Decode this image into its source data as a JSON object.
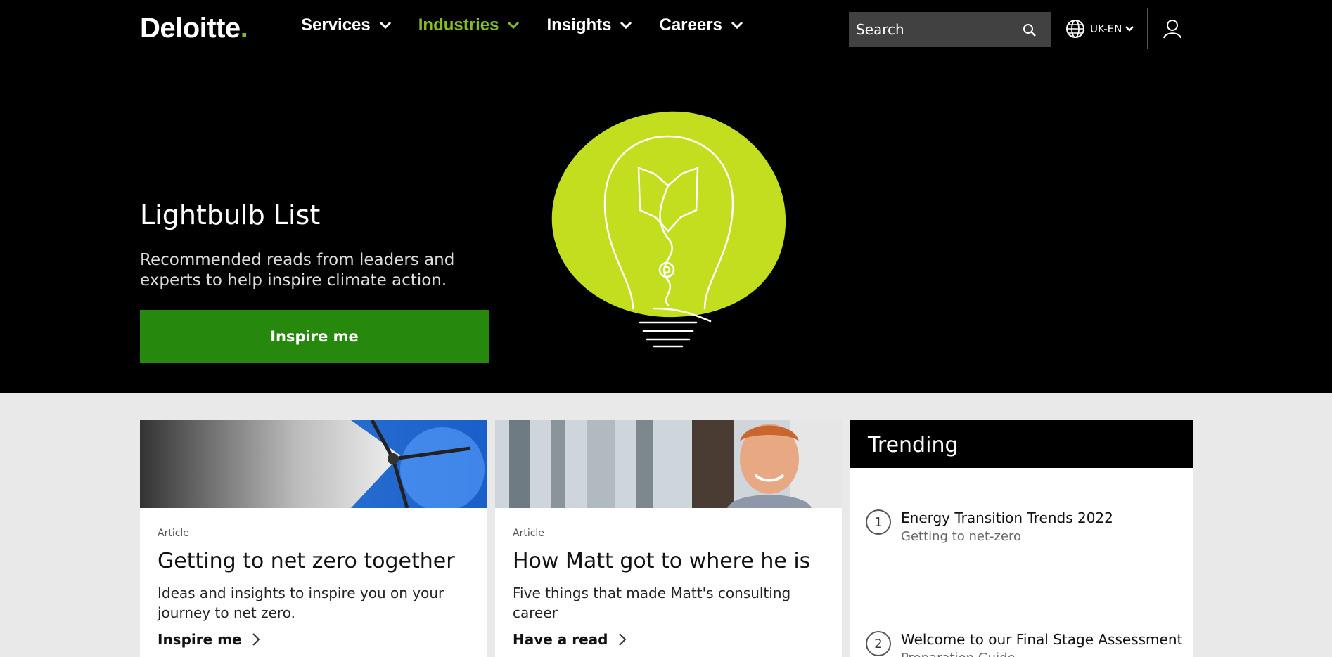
{
  "header": {
    "logo_text": "Deloitte",
    "logo_dot": ".",
    "nav": [
      {
        "label": "Services"
      },
      {
        "label": "Industries"
      },
      {
        "label": "Insights"
      },
      {
        "label": "Careers"
      }
    ],
    "search_placeholder": "Search",
    "language": "UK-EN",
    "colors": {
      "brand_green": "#86bc25",
      "button_green": "#26890d"
    }
  },
  "hero": {
    "title": "Lightbulb List",
    "subtitle": "Recommended reads from leaders and experts to help inspire climate action.",
    "button_label": "Inspire me"
  },
  "cards": [
    {
      "type": "Article",
      "title": "Getting to net zero together",
      "description": "Ideas and insights to inspire you on your journey to net zero.",
      "link": "Inspire me"
    },
    {
      "type": "Article",
      "title": "How Matt got to where he is",
      "description": "Five things that made Matt's consulting career",
      "link": "Have a read"
    }
  ],
  "trending": {
    "heading": "Trending",
    "items": [
      {
        "num": "1",
        "title": "Energy Transition Trends 2022",
        "subtitle": "Getting to net-zero"
      },
      {
        "num": "2",
        "title": "Welcome to our Final Stage Assessment",
        "subtitle": "Preparation Guide"
      }
    ]
  }
}
